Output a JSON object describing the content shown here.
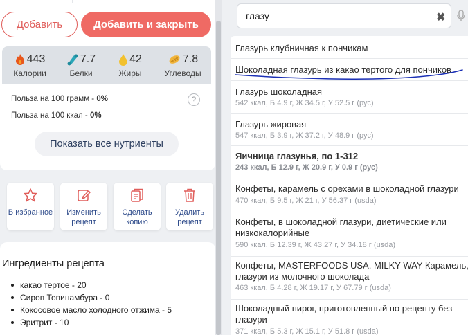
{
  "buttons": {
    "add": "Добавить",
    "add_and_close": "Добавить и закрыть",
    "show_all_nutrients": "Показать все нутриенты"
  },
  "nutrients": [
    {
      "icon": "fire-icon",
      "value": "443",
      "label": "Калории",
      "color": "#e8571c"
    },
    {
      "icon": "protein-icon",
      "value": "7.7",
      "label": "Белки",
      "color": "#2aa6b8"
    },
    {
      "icon": "drop-icon",
      "value": "42",
      "label": "Жиры",
      "color": "#f2c12e"
    },
    {
      "icon": "carb-icon",
      "value": "7.8",
      "label": "Углеводы",
      "color": "#f1b43a"
    }
  ],
  "benefit": {
    "per_100g_label": "Польза на 100 грамм - ",
    "per_100g_value": "0%",
    "per_100kcal_label": "Польза на 100 ккал - ",
    "per_100kcal_value": "0%"
  },
  "actions": [
    {
      "icon": "star-icon",
      "label": "В избранное"
    },
    {
      "icon": "edit-icon",
      "label": "Изменить рецепт"
    },
    {
      "icon": "copy-icon",
      "label": "Сделать копию"
    },
    {
      "icon": "trash-icon",
      "label": "Удалить рецепт"
    }
  ],
  "ingredients": {
    "title": "Ингредиенты рецепта",
    "items": [
      "какао тертое - 20",
      "Сироп Топинамбура - 0",
      "Кокосовое масло холодного отжима - 5",
      "Эритрит - 10"
    ]
  },
  "search": {
    "value": "глазу",
    "clear": "✖"
  },
  "results": [
    {
      "name": "Глазурь клубничная к пончикам",
      "info": ""
    },
    {
      "name": "Шоколадная глазурь из какао тертого для пончиков",
      "info": ""
    },
    {
      "name": "Глазурь шоколадная",
      "info": "542 ккал, Б 4.9 г, Ж 34.5 г, У 52.5 г (рус)"
    },
    {
      "name": "Глазурь жировая",
      "info": "547 ккал, Б 3.9 г, Ж 37.2 г, У 48.9 г (рус)"
    },
    {
      "name": "Яичница глазунья, по 1-312",
      "info": "243 ккал, Б 12.9 г, Ж 20.9 г, У 0.9 г (рус)"
    },
    {
      "name": "Конфеты, карамель с орехами в шоколадной глазури",
      "info": "470 ккал, Б 9.5 г, Ж 21 г, У 56.37 г (usda)"
    },
    {
      "name1": "Конфеты, в шоколадной глазури, диетические или",
      "name2": "низкокалорийные",
      "info": "590 ккал, Б 12.39 г, Ж 43.27 г, У 34.18 г (usda)"
    },
    {
      "name1": "Конфеты, MASTERFOODS USA, MILKY WAY Карамель, в",
      "name2": "глазури из молочного шоколада",
      "info": "463 ккал, Б 4.28 г, Ж 19.17 г, У 67.79 г (usda)"
    },
    {
      "name1": "Шоколадный пирог, приготовленный по рецепту без",
      "name2": "глазури",
      "info": "371 ккал, Б 5.3 г, Ж 15.1 г, У 51.8 г (usda)"
    }
  ],
  "colors": {
    "accent": "#ef6a64",
    "link": "#2d4a8a",
    "annotation": "#1a2fb5"
  }
}
